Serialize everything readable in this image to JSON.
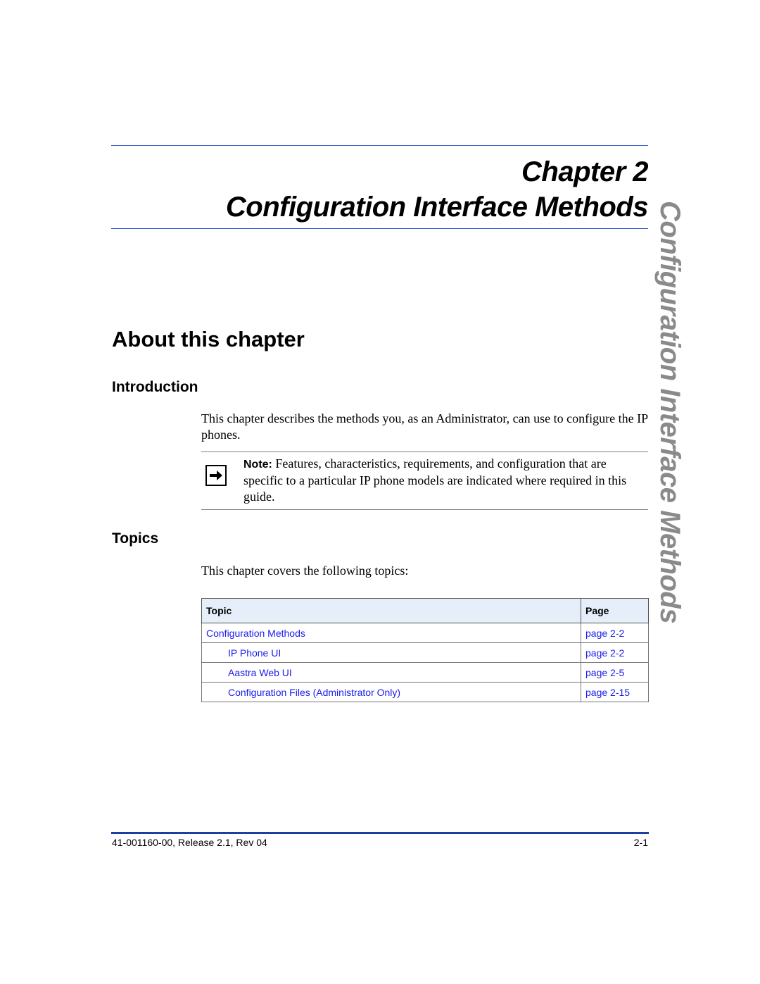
{
  "header": {
    "chapter_label": "Chapter 2",
    "chapter_title": "Configuration Interface Methods"
  },
  "side_tab": "Configuration Interface Methods",
  "section": {
    "title": "About this chapter",
    "introduction": {
      "heading": "Introduction",
      "paragraph": "This chapter describes the methods you, as an Administrator, can use to configure the IP phones.",
      "note": {
        "icon": "arrow-right-icon",
        "label": "Note:",
        "text": " Features, characteristics, requirements, and configuration that are specific to a particular IP phone models are indicated where required in this guide."
      }
    },
    "topics": {
      "heading": "Topics",
      "paragraph": "This chapter covers the following topics:",
      "table": {
        "headers": [
          "Topic",
          "Page"
        ],
        "rows": [
          {
            "topic": "Configuration Methods",
            "page": "page 2-2",
            "indent": false
          },
          {
            "topic": "IP Phone UI",
            "page": "page 2-2",
            "indent": true
          },
          {
            "topic": "Aastra Web UI",
            "page": "page 2-5",
            "indent": true
          },
          {
            "topic": "Configuration Files (Administrator Only)",
            "page": "page 2-15",
            "indent": true
          }
        ]
      }
    }
  },
  "footer": {
    "doc_id": "41-001160-00, Release 2.1, Rev 04",
    "page_number": "2-1"
  },
  "colors": {
    "rule_blue": "#3355cc",
    "link_blue": "#1a1aee",
    "table_header_bg": "#e6eef9",
    "side_tab_gray": "#8a8a8a",
    "footer_rule": "#1c3fa0"
  }
}
